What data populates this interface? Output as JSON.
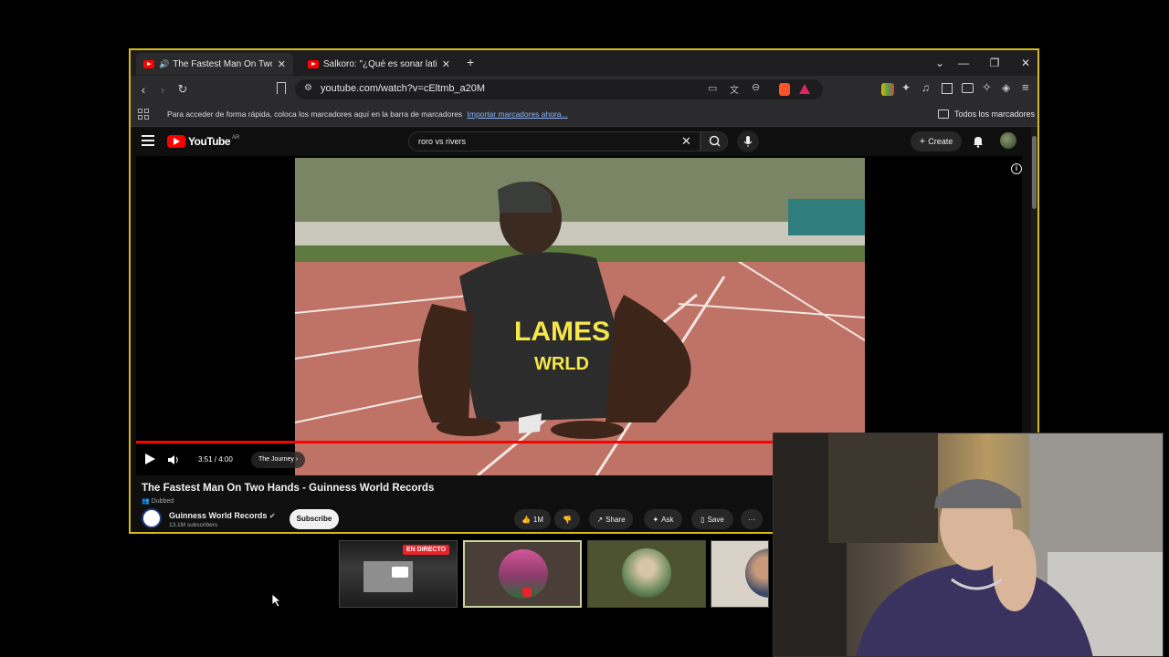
{
  "browser": {
    "tabs": [
      {
        "title": "The Fastest Man On Two Han",
        "active": true
      },
      {
        "title": "Salkoro: \"¿Qué es sonar latino?\" | Em",
        "active": false
      }
    ],
    "new_tab": "+",
    "url": "youtube.com/watch?v=cEltmb_a20M",
    "bookmarks_message": "Para acceder de forma rápida, coloca los marcadores aquí en la barra de marcadores",
    "bookmarks_import_link": "Importar marcadores ahora...",
    "bookmarks_all": "Todos los marcadores"
  },
  "youtube": {
    "logo_text": "YouTube",
    "logo_sup": "AR",
    "search_query": "roro vs rivers",
    "create_label": "Create",
    "player": {
      "current_time": "3:51",
      "duration": "4:00",
      "time_display": "3:51 / 4:00",
      "progress_fraction": 0.9625,
      "chapter": "The Journey",
      "shirt_text_1": "LAMES",
      "shirt_text_2": "WRLD"
    },
    "video": {
      "title": "The Fastest Man On Two Hands - Guinness World Records",
      "badge": "Dubbed",
      "channel_name": "Guinness World Records",
      "subscribers": "13.1M subscribers",
      "subscribe_label": "Subscribe",
      "likes": "1M",
      "share_label": "Share",
      "ask_label": "Ask",
      "save_label": "Save",
      "more_label": "···"
    }
  },
  "overlay": {
    "live_badge": "EN DIRECTO"
  },
  "colors": {
    "window_border": "#d6b81a",
    "yt_red": "#ff0000",
    "link_blue": "#8ab4f8"
  }
}
